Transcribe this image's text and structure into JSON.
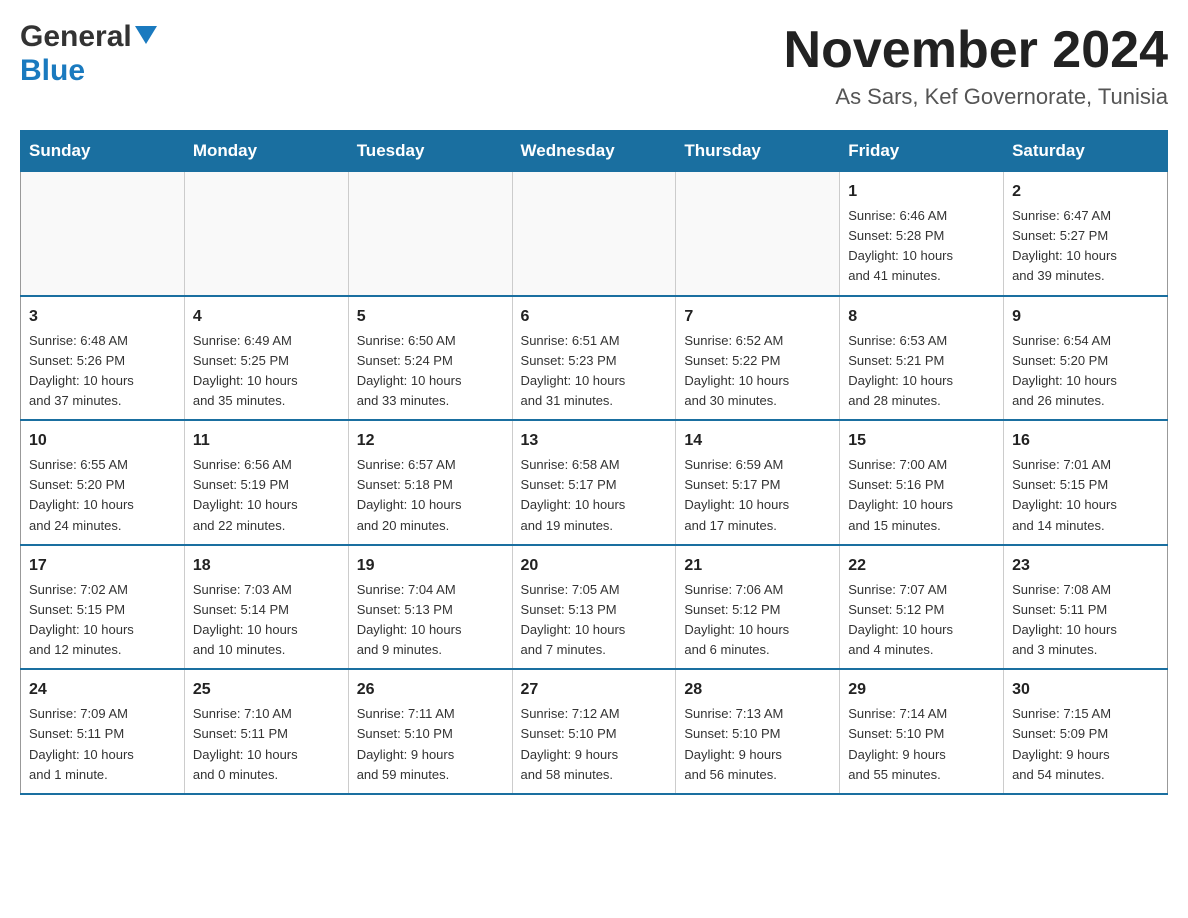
{
  "header": {
    "logo_general": "General",
    "logo_blue": "Blue",
    "month_title": "November 2024",
    "location": "As Sars, Kef Governorate, Tunisia"
  },
  "weekdays": [
    "Sunday",
    "Monday",
    "Tuesday",
    "Wednesday",
    "Thursday",
    "Friday",
    "Saturday"
  ],
  "weeks": [
    [
      {
        "day": "",
        "info": ""
      },
      {
        "day": "",
        "info": ""
      },
      {
        "day": "",
        "info": ""
      },
      {
        "day": "",
        "info": ""
      },
      {
        "day": "",
        "info": ""
      },
      {
        "day": "1",
        "info": "Sunrise: 6:46 AM\nSunset: 5:28 PM\nDaylight: 10 hours\nand 41 minutes."
      },
      {
        "day": "2",
        "info": "Sunrise: 6:47 AM\nSunset: 5:27 PM\nDaylight: 10 hours\nand 39 minutes."
      }
    ],
    [
      {
        "day": "3",
        "info": "Sunrise: 6:48 AM\nSunset: 5:26 PM\nDaylight: 10 hours\nand 37 minutes."
      },
      {
        "day": "4",
        "info": "Sunrise: 6:49 AM\nSunset: 5:25 PM\nDaylight: 10 hours\nand 35 minutes."
      },
      {
        "day": "5",
        "info": "Sunrise: 6:50 AM\nSunset: 5:24 PM\nDaylight: 10 hours\nand 33 minutes."
      },
      {
        "day": "6",
        "info": "Sunrise: 6:51 AM\nSunset: 5:23 PM\nDaylight: 10 hours\nand 31 minutes."
      },
      {
        "day": "7",
        "info": "Sunrise: 6:52 AM\nSunset: 5:22 PM\nDaylight: 10 hours\nand 30 minutes."
      },
      {
        "day": "8",
        "info": "Sunrise: 6:53 AM\nSunset: 5:21 PM\nDaylight: 10 hours\nand 28 minutes."
      },
      {
        "day": "9",
        "info": "Sunrise: 6:54 AM\nSunset: 5:20 PM\nDaylight: 10 hours\nand 26 minutes."
      }
    ],
    [
      {
        "day": "10",
        "info": "Sunrise: 6:55 AM\nSunset: 5:20 PM\nDaylight: 10 hours\nand 24 minutes."
      },
      {
        "day": "11",
        "info": "Sunrise: 6:56 AM\nSunset: 5:19 PM\nDaylight: 10 hours\nand 22 minutes."
      },
      {
        "day": "12",
        "info": "Sunrise: 6:57 AM\nSunset: 5:18 PM\nDaylight: 10 hours\nand 20 minutes."
      },
      {
        "day": "13",
        "info": "Sunrise: 6:58 AM\nSunset: 5:17 PM\nDaylight: 10 hours\nand 19 minutes."
      },
      {
        "day": "14",
        "info": "Sunrise: 6:59 AM\nSunset: 5:17 PM\nDaylight: 10 hours\nand 17 minutes."
      },
      {
        "day": "15",
        "info": "Sunrise: 7:00 AM\nSunset: 5:16 PM\nDaylight: 10 hours\nand 15 minutes."
      },
      {
        "day": "16",
        "info": "Sunrise: 7:01 AM\nSunset: 5:15 PM\nDaylight: 10 hours\nand 14 minutes."
      }
    ],
    [
      {
        "day": "17",
        "info": "Sunrise: 7:02 AM\nSunset: 5:15 PM\nDaylight: 10 hours\nand 12 minutes."
      },
      {
        "day": "18",
        "info": "Sunrise: 7:03 AM\nSunset: 5:14 PM\nDaylight: 10 hours\nand 10 minutes."
      },
      {
        "day": "19",
        "info": "Sunrise: 7:04 AM\nSunset: 5:13 PM\nDaylight: 10 hours\nand 9 minutes."
      },
      {
        "day": "20",
        "info": "Sunrise: 7:05 AM\nSunset: 5:13 PM\nDaylight: 10 hours\nand 7 minutes."
      },
      {
        "day": "21",
        "info": "Sunrise: 7:06 AM\nSunset: 5:12 PM\nDaylight: 10 hours\nand 6 minutes."
      },
      {
        "day": "22",
        "info": "Sunrise: 7:07 AM\nSunset: 5:12 PM\nDaylight: 10 hours\nand 4 minutes."
      },
      {
        "day": "23",
        "info": "Sunrise: 7:08 AM\nSunset: 5:11 PM\nDaylight: 10 hours\nand 3 minutes."
      }
    ],
    [
      {
        "day": "24",
        "info": "Sunrise: 7:09 AM\nSunset: 5:11 PM\nDaylight: 10 hours\nand 1 minute."
      },
      {
        "day": "25",
        "info": "Sunrise: 7:10 AM\nSunset: 5:11 PM\nDaylight: 10 hours\nand 0 minutes."
      },
      {
        "day": "26",
        "info": "Sunrise: 7:11 AM\nSunset: 5:10 PM\nDaylight: 9 hours\nand 59 minutes."
      },
      {
        "day": "27",
        "info": "Sunrise: 7:12 AM\nSunset: 5:10 PM\nDaylight: 9 hours\nand 58 minutes."
      },
      {
        "day": "28",
        "info": "Sunrise: 7:13 AM\nSunset: 5:10 PM\nDaylight: 9 hours\nand 56 minutes."
      },
      {
        "day": "29",
        "info": "Sunrise: 7:14 AM\nSunset: 5:10 PM\nDaylight: 9 hours\nand 55 minutes."
      },
      {
        "day": "30",
        "info": "Sunrise: 7:15 AM\nSunset: 5:09 PM\nDaylight: 9 hours\nand 54 minutes."
      }
    ]
  ]
}
